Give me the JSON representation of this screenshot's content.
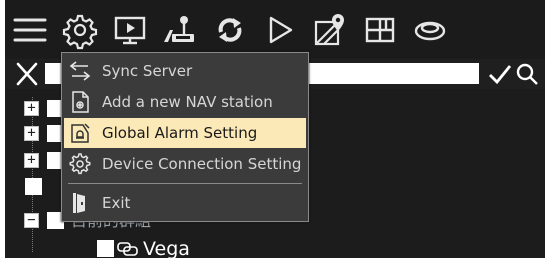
{
  "toolbar": {
    "icons": [
      {
        "name": "menu-icon"
      },
      {
        "name": "gear-icon"
      },
      {
        "name": "monitor-play-icon"
      },
      {
        "name": "joystick-icon"
      },
      {
        "name": "sync-arrows-icon"
      },
      {
        "name": "play-icon"
      },
      {
        "name": "map-pin-icon"
      },
      {
        "name": "grid-layout-icon"
      },
      {
        "name": "disc-icon"
      }
    ]
  },
  "search": {
    "value": "",
    "placeholder": ""
  },
  "tree": {
    "nodes": [
      {
        "expander": "+"
      },
      {
        "expander": "+"
      },
      {
        "expander": "+"
      },
      {
        "expander": ""
      },
      {
        "expander": "−",
        "label": "目前的群組"
      }
    ],
    "child": {
      "label": "Vega",
      "icon": "camera-group-icon"
    }
  },
  "menu": {
    "items": [
      {
        "label": "Sync Server",
        "icon": "sync-icon"
      },
      {
        "label": "Add a new NAV station",
        "icon": "document-add-icon"
      },
      {
        "label": "Global Alarm Setting",
        "icon": "alarm-setting-icon",
        "selected": true
      },
      {
        "label": "Device Connection Setting",
        "icon": "gear-icon"
      },
      {
        "label": "Exit",
        "icon": "exit-door-icon"
      }
    ]
  },
  "colors": {
    "background": "#1c1c1c",
    "menu_background": "#3b3b3b",
    "menu_highlight": "#fbe9b7",
    "icon_stroke": "#e6e6e6"
  }
}
